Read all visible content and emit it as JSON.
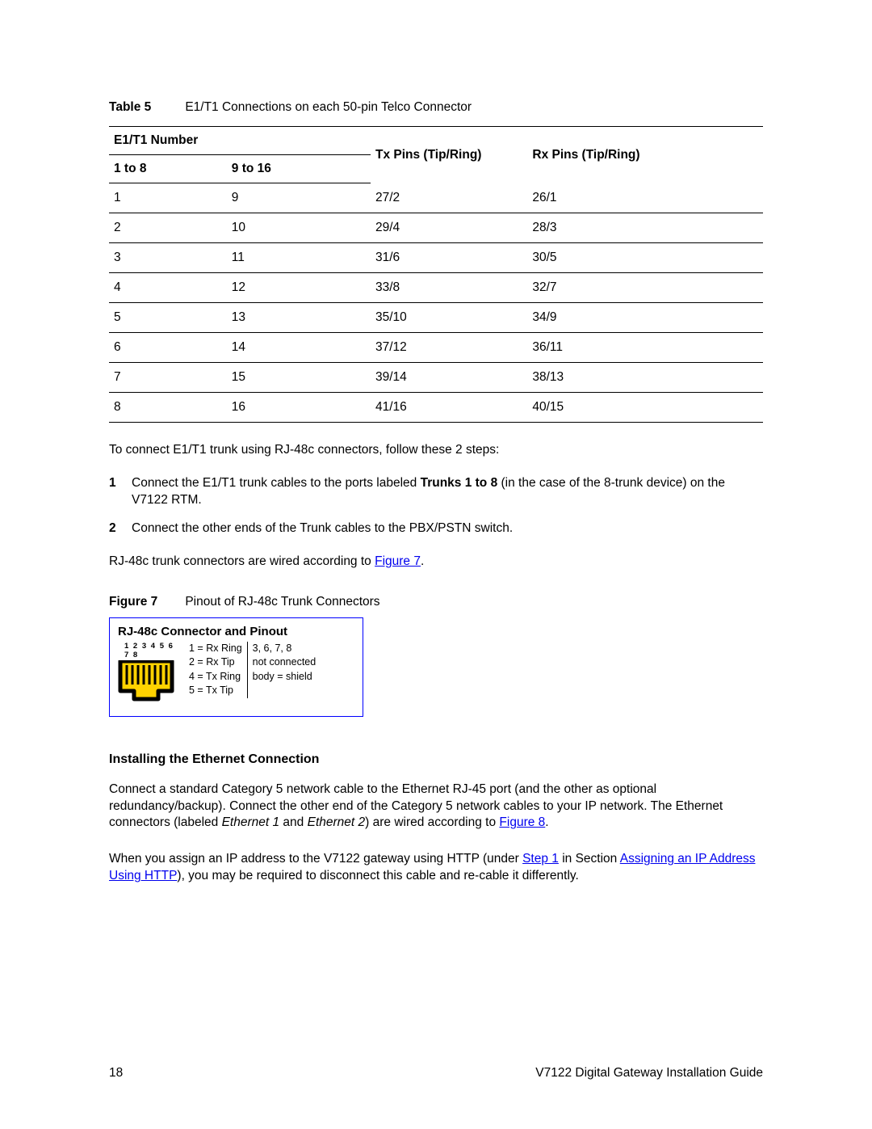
{
  "table5": {
    "label": "Table 5",
    "caption": "E1/T1 Connections on each 50-pin Telco Connector",
    "head_group": "E1/T1 Number",
    "head_tx": "Tx Pins (Tip/Ring)",
    "head_rx": "Rx Pins (Tip/Ring)",
    "sub1": "1 to 8",
    "sub2": "9 to 16",
    "rows": [
      {
        "a": "1",
        "b": "9",
        "tx": "27/2",
        "rx": "26/1"
      },
      {
        "a": "2",
        "b": "10",
        "tx": "29/4",
        "rx": "28/3"
      },
      {
        "a": "3",
        "b": "11",
        "tx": "31/6",
        "rx": "30/5"
      },
      {
        "a": "4",
        "b": "12",
        "tx": "33/8",
        "rx": "32/7"
      },
      {
        "a": "5",
        "b": "13",
        "tx": "35/10",
        "rx": "34/9"
      },
      {
        "a": "6",
        "b": "14",
        "tx": "37/12",
        "rx": "36/11"
      },
      {
        "a": "7",
        "b": "15",
        "tx": "39/14",
        "rx": "38/13"
      },
      {
        "a": "8",
        "b": "16",
        "tx": "41/16",
        "rx": "40/15"
      }
    ]
  },
  "intro": "To connect E1/T1 trunk using RJ-48c connectors, follow these 2 steps:",
  "steps": [
    {
      "n": "1",
      "pre": "Connect the E1/T1 trunk cables to the ports labeled ",
      "bold": "Trunks 1 to 8",
      "post": " (in the case of the 8-trunk device) on the V7122 RTM."
    },
    {
      "n": "2",
      "pre": "Connect the other ends of the Trunk cables to the PBX/PSTN switch.",
      "bold": "",
      "post": ""
    }
  ],
  "rj48_sentence_pre": "RJ-48c trunk connectors are wired according to ",
  "rj48_link": "Figure 7",
  "rj48_sentence_post": ".",
  "figure7": {
    "label": "Figure 7",
    "caption": "Pinout of RJ-48c Trunk Connectors",
    "title": "RJ-48c Connector and Pinout",
    "pinlabels": "1 2 3 4 5 6 7 8",
    "col1": [
      "1 = Rx Ring",
      "2 = Rx Tip",
      "4 = Tx Ring",
      "5 = Tx Tip"
    ],
    "col2": [
      "3, 6, 7, 8",
      "not connected",
      "",
      "body = shield"
    ]
  },
  "section_heading": "Installing the Ethernet Connection",
  "eth_para_pre": "Connect a standard Category 5 network cable to the Ethernet RJ-45 port (and the other as optional redundancy/backup). Connect the other end of the Category 5 network cables to your IP network. The Ethernet connectors (labeled ",
  "eth_em1": "Ethernet 1",
  "eth_mid": " and ",
  "eth_em2": "Ethernet 2",
  "eth_para_post1": ") are wired according to ",
  "eth_link": "Figure 8",
  "eth_para_post2": ".",
  "ip_para_pre": "When you assign an IP address to the V7122 gateway using HTTP (under ",
  "ip_link1": "Step 1",
  "ip_mid": " in Section ",
  "ip_link2": "Assigning an IP Address Using HTTP",
  "ip_para_post": "), you may be required to disconnect this cable and re-cable it differently.",
  "footer": {
    "page": "18",
    "doc": "V7122 Digital Gateway Installation Guide"
  }
}
